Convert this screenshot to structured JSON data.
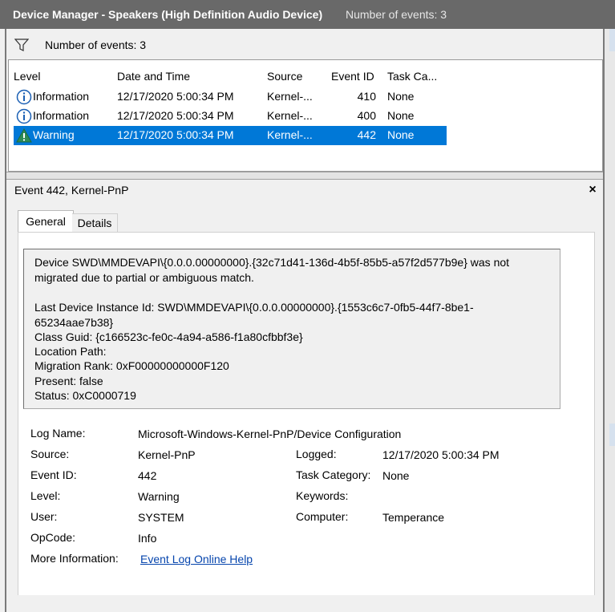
{
  "window": {
    "title": "Device Manager - Speakers (High Definition Audio Device)",
    "event_count_title": "Number of events: 3"
  },
  "filter": {
    "icon": "filter-icon",
    "text": "Number of events: 3"
  },
  "events_table": {
    "columns": [
      "Level",
      "Date and Time",
      "Source",
      "Event ID",
      "Task Ca..."
    ],
    "rows": [
      {
        "level": "Information",
        "icon": "info-icon",
        "datetime": "12/17/2020 5:00:34 PM",
        "source": "Kernel-...",
        "event_id": "410",
        "task": "None",
        "selected": false
      },
      {
        "level": "Information",
        "icon": "info-icon",
        "datetime": "12/17/2020 5:00:34 PM",
        "source": "Kernel-...",
        "event_id": "400",
        "task": "None",
        "selected": false
      },
      {
        "level": "Warning",
        "icon": "warning-icon",
        "datetime": "12/17/2020 5:00:34 PM",
        "source": "Kernel-...",
        "event_id": "442",
        "task": "None",
        "selected": true
      }
    ]
  },
  "detail": {
    "header_title": "Event 442, Kernel-PnP",
    "close_label": "×",
    "tabs": [
      {
        "label": "General",
        "active": true
      },
      {
        "label": "Details",
        "active": false
      }
    ],
    "description_lines": [
      "Device SWD\\MMDEVAPI\\{0.0.0.00000000}.{32c71d41-136d-4b5f-85b5-a57f2d577b9e} was not",
      "migrated due to partial or ambiguous match.",
      "",
      "Last Device Instance Id: SWD\\MMDEVAPI\\{0.0.0.00000000}.{1553c6c7-0fb5-44f7-8be1-",
      "65234aae7b38}",
      "Class Guid: {c166523c-fe0c-4a94-a586-f1a80cfbbf3e}",
      "Location Path:",
      "Migration Rank: 0xF00000000000F120",
      "Present: false",
      "Status: 0xC0000719"
    ],
    "properties": {
      "log_name_label": "Log Name:",
      "log_name": "Microsoft-Windows-Kernel-PnP/Device Configuration",
      "source_label": "Source:",
      "source": "Kernel-PnP",
      "logged_label": "Logged:",
      "logged": "12/17/2020 5:00:34 PM",
      "event_id_label": "Event ID:",
      "event_id": "442",
      "task_category_label": "Task Category:",
      "task_category": "None",
      "level_label": "Level:",
      "level": "Warning",
      "keywords_label": "Keywords:",
      "keywords": "",
      "user_label": "User:",
      "user": "SYSTEM",
      "computer_label": "Computer:",
      "computer": "Temperance",
      "opcode_label": "OpCode:",
      "opcode": "Info",
      "more_info_label": "More Information:",
      "more_info_link": "Event Log Online Help"
    }
  },
  "colors": {
    "titlebar": "#696969",
    "selection": "#0078d7",
    "link": "#0645ad",
    "warning": "#2e8b57"
  }
}
